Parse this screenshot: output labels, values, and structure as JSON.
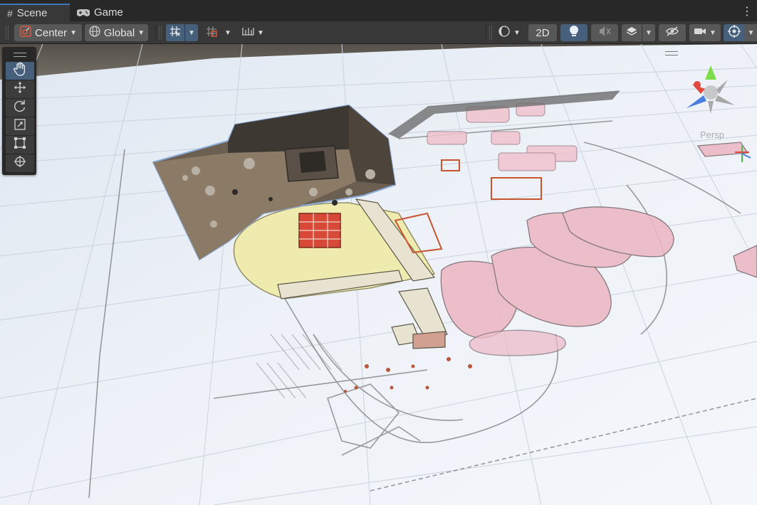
{
  "tabs": [
    {
      "label": "Scene",
      "icon": "hash-icon",
      "active": true
    },
    {
      "label": "Game",
      "icon": "gamepad-icon",
      "active": false
    }
  ],
  "toolbar": {
    "pivot_mode": "Center",
    "pivot_rotation": "Global",
    "view_2d_label": "2D"
  },
  "gizmo": {
    "projection_label": "Persp"
  },
  "tools": [
    "hand-tool",
    "move-tool",
    "rotate-tool",
    "scale-tool",
    "rect-tool",
    "transform-tool"
  ],
  "colors": {
    "accent": "#46607c",
    "tab_highlight": "#3a79bb",
    "gizmo_x": "#e0473f",
    "gizmo_y": "#7ddc4a",
    "gizmo_z": "#4a7fe0"
  }
}
